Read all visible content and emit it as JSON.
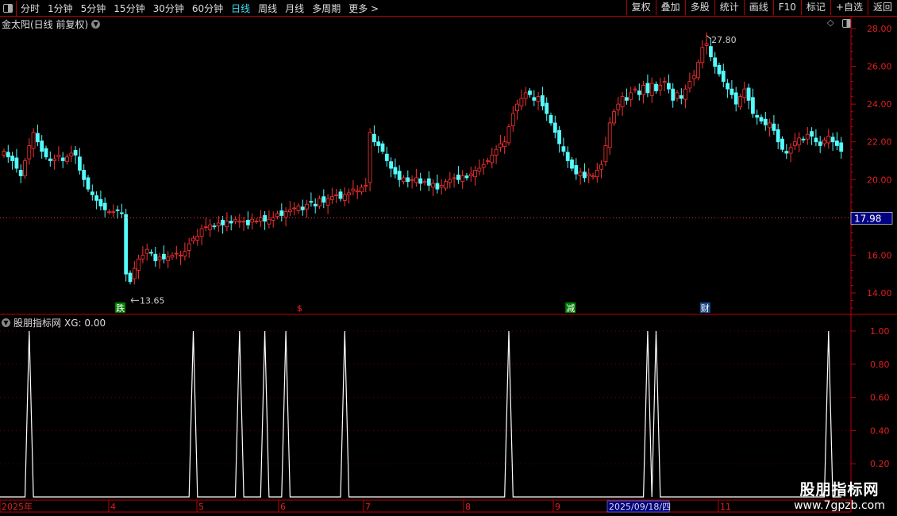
{
  "toolbar": {
    "periods": [
      "分时",
      "1分钟",
      "5分钟",
      "15分钟",
      "30分钟",
      "60分钟",
      "日线",
      "周线",
      "月线",
      "多周期",
      "更多 >"
    ],
    "active_period": "日线",
    "tools": [
      "复权",
      "叠加",
      "多股",
      "统计",
      "画线",
      "F10",
      "标记",
      "+自选",
      "返回"
    ]
  },
  "main": {
    "title": "金太阳(日线 前复权)",
    "current_price_label": "17.98",
    "max_label": "27.80",
    "min_label": "13.65",
    "markers": [
      {
        "text": "跌",
        "color": "#008000"
      },
      {
        "text": "$",
        "color": "#ff2020"
      },
      {
        "text": "减",
        "color": "#008000"
      },
      {
        "text": "财",
        "color": "#1a4a8a"
      }
    ]
  },
  "indicator": {
    "title": "股朋指标网",
    "readout": "XG: 0.00"
  },
  "watermark": {
    "line1": "股朋指标网",
    "line2": "www.7gpzb.com"
  },
  "colors": {
    "up": "#ff3232",
    "down": "#54fcfc",
    "axis": "#c00000",
    "accent": "#3fe0f0",
    "highlight_bg": "#000080"
  },
  "chart_data": [
    {
      "type": "candlestick",
      "title": "金太阳(日线 前复权)",
      "ylim": [
        13.3,
        28.4
      ],
      "y_ticks": [
        "28.00",
        "26.00",
        "24.00",
        "22.00",
        "20.00",
        "18.00",
        "16.00",
        "14.00"
      ],
      "x_ticks": [
        "2025年",
        "4",
        "5",
        "6",
        "7",
        "8",
        "9",
        "2025/09/18/四",
        "11"
      ],
      "max": 27.8,
      "min": 13.65,
      "last": 17.98,
      "close": [
        21.5,
        21.2,
        21.0,
        20.6,
        20.2,
        21.0,
        21.8,
        22.5,
        22.0,
        21.5,
        21.2,
        21.0,
        21.1,
        21.3,
        21.0,
        21.2,
        21.4,
        21.3,
        20.5,
        20.0,
        19.5,
        19.2,
        18.9,
        18.6,
        18.4,
        18.3,
        18.3,
        18.4,
        18.2,
        15.0,
        14.6,
        15.3,
        15.8,
        16.0,
        16.3,
        16.1,
        15.7,
        15.9,
        15.8,
        15.9,
        16.0,
        16.1,
        16.0,
        16.2,
        16.6,
        16.9,
        17.0,
        17.4,
        17.5,
        17.6,
        17.5,
        17.7,
        17.6,
        17.8,
        17.7,
        17.9,
        17.8,
        17.8,
        17.6,
        17.9,
        17.8,
        18.0,
        17.8,
        17.9,
        18.0,
        18.2,
        18.1,
        18.3,
        18.4,
        18.5,
        18.6,
        18.4,
        18.7,
        18.8,
        18.6,
        19.0,
        18.8,
        19.0,
        19.1,
        19.2,
        19.0,
        19.2,
        19.3,
        19.5,
        19.4,
        19.6,
        19.7,
        22.5,
        22.0,
        21.8,
        21.5,
        21.0,
        20.6,
        20.3,
        20.0,
        20.1,
        19.9,
        20.0,
        20.1,
        19.8,
        19.9,
        19.7,
        19.8,
        19.5,
        19.7,
        19.9,
        20.0,
        20.1,
        20.0,
        20.2,
        20.1,
        20.3,
        20.5,
        20.6,
        20.8,
        21.0,
        21.3,
        21.6,
        21.9,
        22.0,
        22.8,
        23.5,
        24.0,
        24.3,
        24.6,
        24.5,
        24.2,
        24.4,
        23.9,
        23.5,
        23.0,
        22.5,
        21.9,
        21.5,
        21.0,
        20.6,
        20.3,
        20.4,
        20.1,
        20.3,
        20.2,
        20.5,
        20.8,
        21.8,
        23.0,
        23.6,
        24.0,
        24.4,
        24.2,
        24.6,
        24.8,
        24.5,
        25.0,
        24.6,
        25.1,
        24.7,
        25.0,
        25.2,
        24.8,
        24.2,
        24.6,
        24.3,
        24.8,
        25.2,
        25.5,
        26.2,
        27.0,
        27.2,
        26.5,
        26.0,
        25.6,
        25.2,
        24.8,
        24.5,
        24.0,
        24.4,
        24.8,
        24.2,
        23.5,
        23.3,
        23.1,
        22.9,
        23.0,
        22.6,
        22.0,
        21.6,
        21.4,
        21.7,
        22.0,
        22.2,
        22.1,
        22.4,
        22.3,
        22.0,
        21.8,
        22.1,
        22.3,
        22.0,
        21.8,
        21.5
      ]
    },
    {
      "type": "line",
      "series": [
        {
          "name": "XG"
        }
      ],
      "ylim": [
        0,
        1.05
      ],
      "y_ticks": [
        "1.00",
        "0.80",
        "0.60",
        "0.40",
        "0.20"
      ],
      "signal_bars": [
        6,
        45,
        56,
        62,
        67,
        81,
        120,
        153,
        155,
        196
      ],
      "signal_value": 1
    }
  ]
}
